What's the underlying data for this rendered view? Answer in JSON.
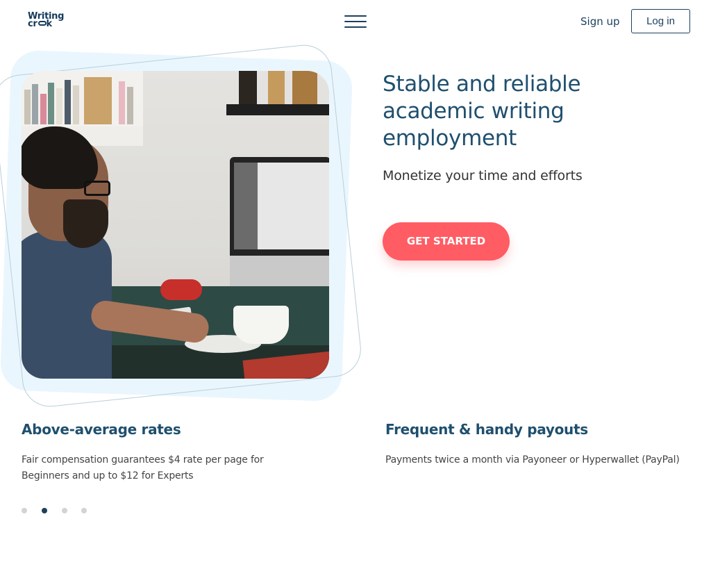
{
  "header": {
    "logo_line1": "Writing",
    "logo_line2_a": "cr",
    "logo_line2_b": "k",
    "signup_label": "Sign up",
    "login_label": "Log in"
  },
  "hero": {
    "title": "Stable and reliable academic writing employment",
    "subtitle": "Monetize your time and efforts",
    "cta_label": "GET STARTED"
  },
  "features": [
    {
      "title": "Above-average rates",
      "text": "Fair compensation guarantees $4 rate per page for Beginners and up to $12 for Experts"
    },
    {
      "title": "Frequent & handy payouts",
      "text": "Payments twice a month via Payoneer or Hyperwallet (PayPal)"
    }
  ],
  "carousel": {
    "dot_count": 4,
    "active_index": 1
  },
  "colors": {
    "brand_navy": "#1d3f5e",
    "cta_coral": "#ff5c63",
    "hero_bg": "#eaf6fd"
  },
  "icons": {
    "menu": "hamburger-icon"
  }
}
